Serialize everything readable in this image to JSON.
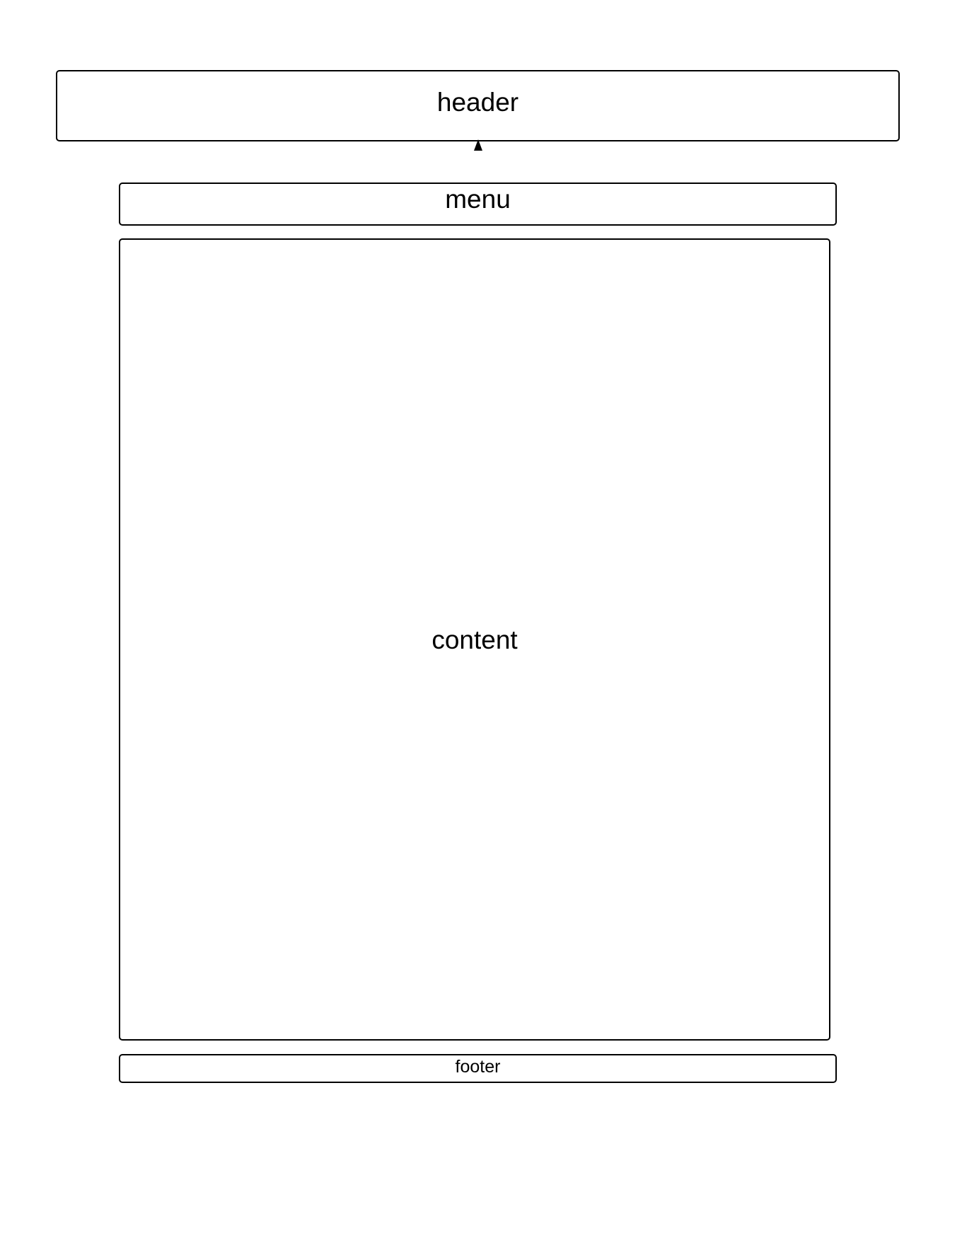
{
  "diagram": {
    "boxes": {
      "header": "header",
      "menu": "menu",
      "content": "content",
      "footer": "footer"
    },
    "connectors": [
      {
        "from": "menu",
        "to": "header",
        "style": "arrow"
      }
    ],
    "colors": {
      "stroke": "#000000",
      "background": "#ffffff",
      "text": "#000000"
    }
  }
}
